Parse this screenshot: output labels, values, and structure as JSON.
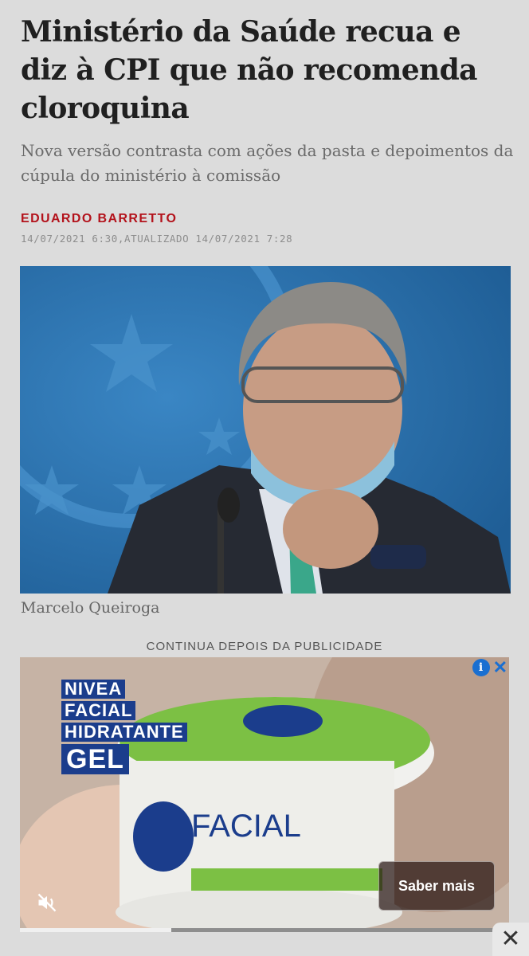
{
  "article": {
    "headline": "Ministério da Saúde recua e diz à CPI que não recomenda cloroquina",
    "subtitle": "Nova versão contrasta com ações da pasta e depoimentos da cúpula do ministério à comissão",
    "author": "EDUARDO BARRETTO",
    "dates": "14/07/2021 6:30,ATUALIZADO 14/07/2021 7:28",
    "photo_caption": "Marcelo Queiroga"
  },
  "ad": {
    "label": "CONTINUA DEPOIS DA PUBLICIDADE",
    "brand_lines": [
      "NIVEA",
      "FACIAL",
      "HIDRATANTE",
      "GEL"
    ],
    "cta_label": "Saber mais",
    "progress": 0.31,
    "info_icon": "info-icon",
    "close_icon": "close-icon",
    "mute_icon": "volume-mute-icon"
  },
  "overlay": {
    "dismiss_icon": "close-icon",
    "dismiss_label": "✕"
  },
  "colors": {
    "author": "#b3121b",
    "ad_blue": "#1b3d8c",
    "info_blue": "#1a6fd1"
  }
}
